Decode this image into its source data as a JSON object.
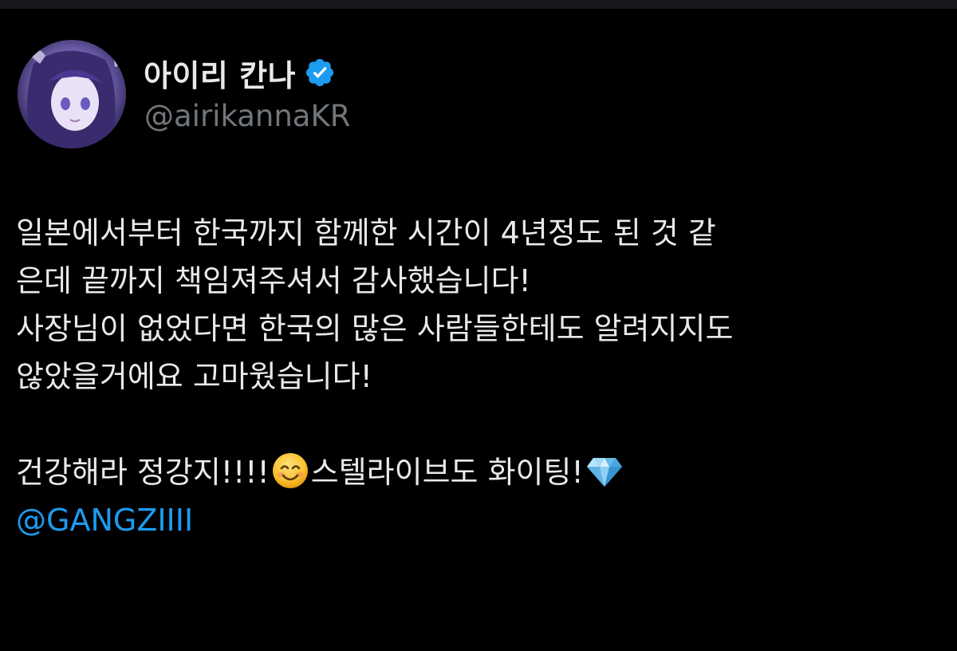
{
  "author": {
    "display_name": "아이리 칸나",
    "handle": "@airikannaKR",
    "verified": true,
    "verified_icon": "verified-badge-icon",
    "avatar_icon": "avatar-image",
    "verified_color": "#1d9bf0"
  },
  "tweet": {
    "lines": [
      "일본에서부터 한국까지 함께한 시간이 4년정도 된 것 같",
      "은데 끝까지 책임져주셔서 감사했습니다!",
      "사장님이 없었다면 한국의 많은 사람들한테도 알려지지도",
      "않았을거에요 고마웠습니다!"
    ],
    "line5_part1": "건강해라 정강지!!!!",
    "line5_emoji1": "smiling-face-emoji",
    "line5_part2": "스텔라이브도 화이팅!",
    "line5_emoji2": "gem-stone-emoji",
    "mention": "@GANGZIIII",
    "mention_color": "#1d9bf0"
  },
  "theme": {
    "background": "#000000",
    "text_color": "#e7e9ea",
    "secondary_text": "#71767b"
  }
}
